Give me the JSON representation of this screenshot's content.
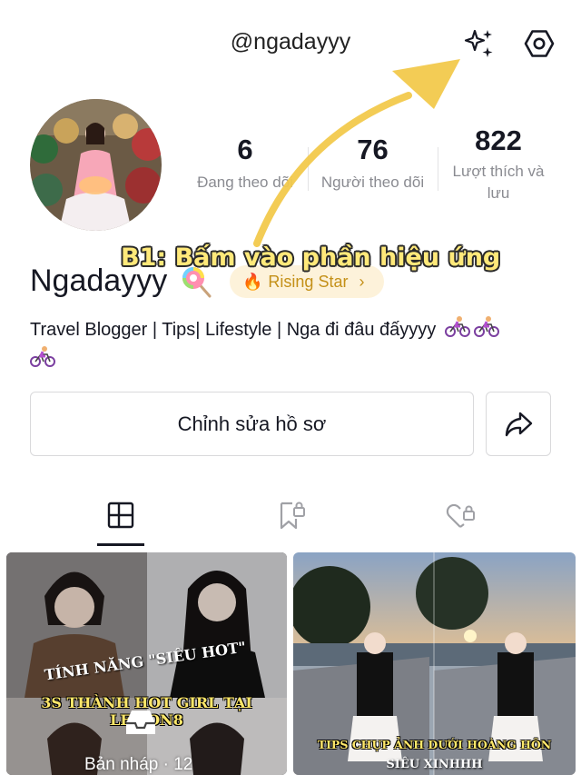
{
  "header": {
    "username": "@ngadayyy",
    "effects_icon": "sparkles-icon",
    "settings_icon": "hexagon-gear-icon"
  },
  "profile": {
    "display_name": "Ngadayyy",
    "name_emoji": "lollipop-icon",
    "badge": {
      "icon": "flame-icon",
      "label": "Rising Star",
      "chevron": "›"
    },
    "stats": [
      {
        "value": "6",
        "label": "Đang theo dõi"
      },
      {
        "value": "76",
        "label": "Người theo dõi"
      },
      {
        "value": "822",
        "label": "Lượt thích và lưu"
      }
    ],
    "bio": "Travel Blogger | Tips| Lifestyle | Nga đi đâu đấyyyy",
    "bio_emoji": "cyclist-icon",
    "edit_button_label": "Chỉnh sửa hồ sơ",
    "share_icon": "share-arrow-icon"
  },
  "tabs": [
    {
      "name": "posts",
      "icon": "grid-layout-icon",
      "active": true
    },
    {
      "name": "saved",
      "icon": "bookmark-lock-icon",
      "active": false
    },
    {
      "name": "liked",
      "icon": "heart-lock-icon",
      "active": false
    }
  ],
  "posts": [
    {
      "overlay_top": "TÍNH NĂNG \"SIÊU HOT\"",
      "overlay_main": "3S THÀNH HOT GIRL TẠI LEMON8",
      "draft_icon": "inbox-tray-icon",
      "draft_label": "Bản nháp · 12"
    },
    {
      "overlay_main": "TIPS CHỤP ẢNH DƯỚI HOÀNG HÔN",
      "overlay_sub": "SIÊU XINHHH"
    }
  ],
  "annotation": {
    "text": "B1: Bấm vào phần hiệu ứng",
    "color": "#f2c94c"
  }
}
